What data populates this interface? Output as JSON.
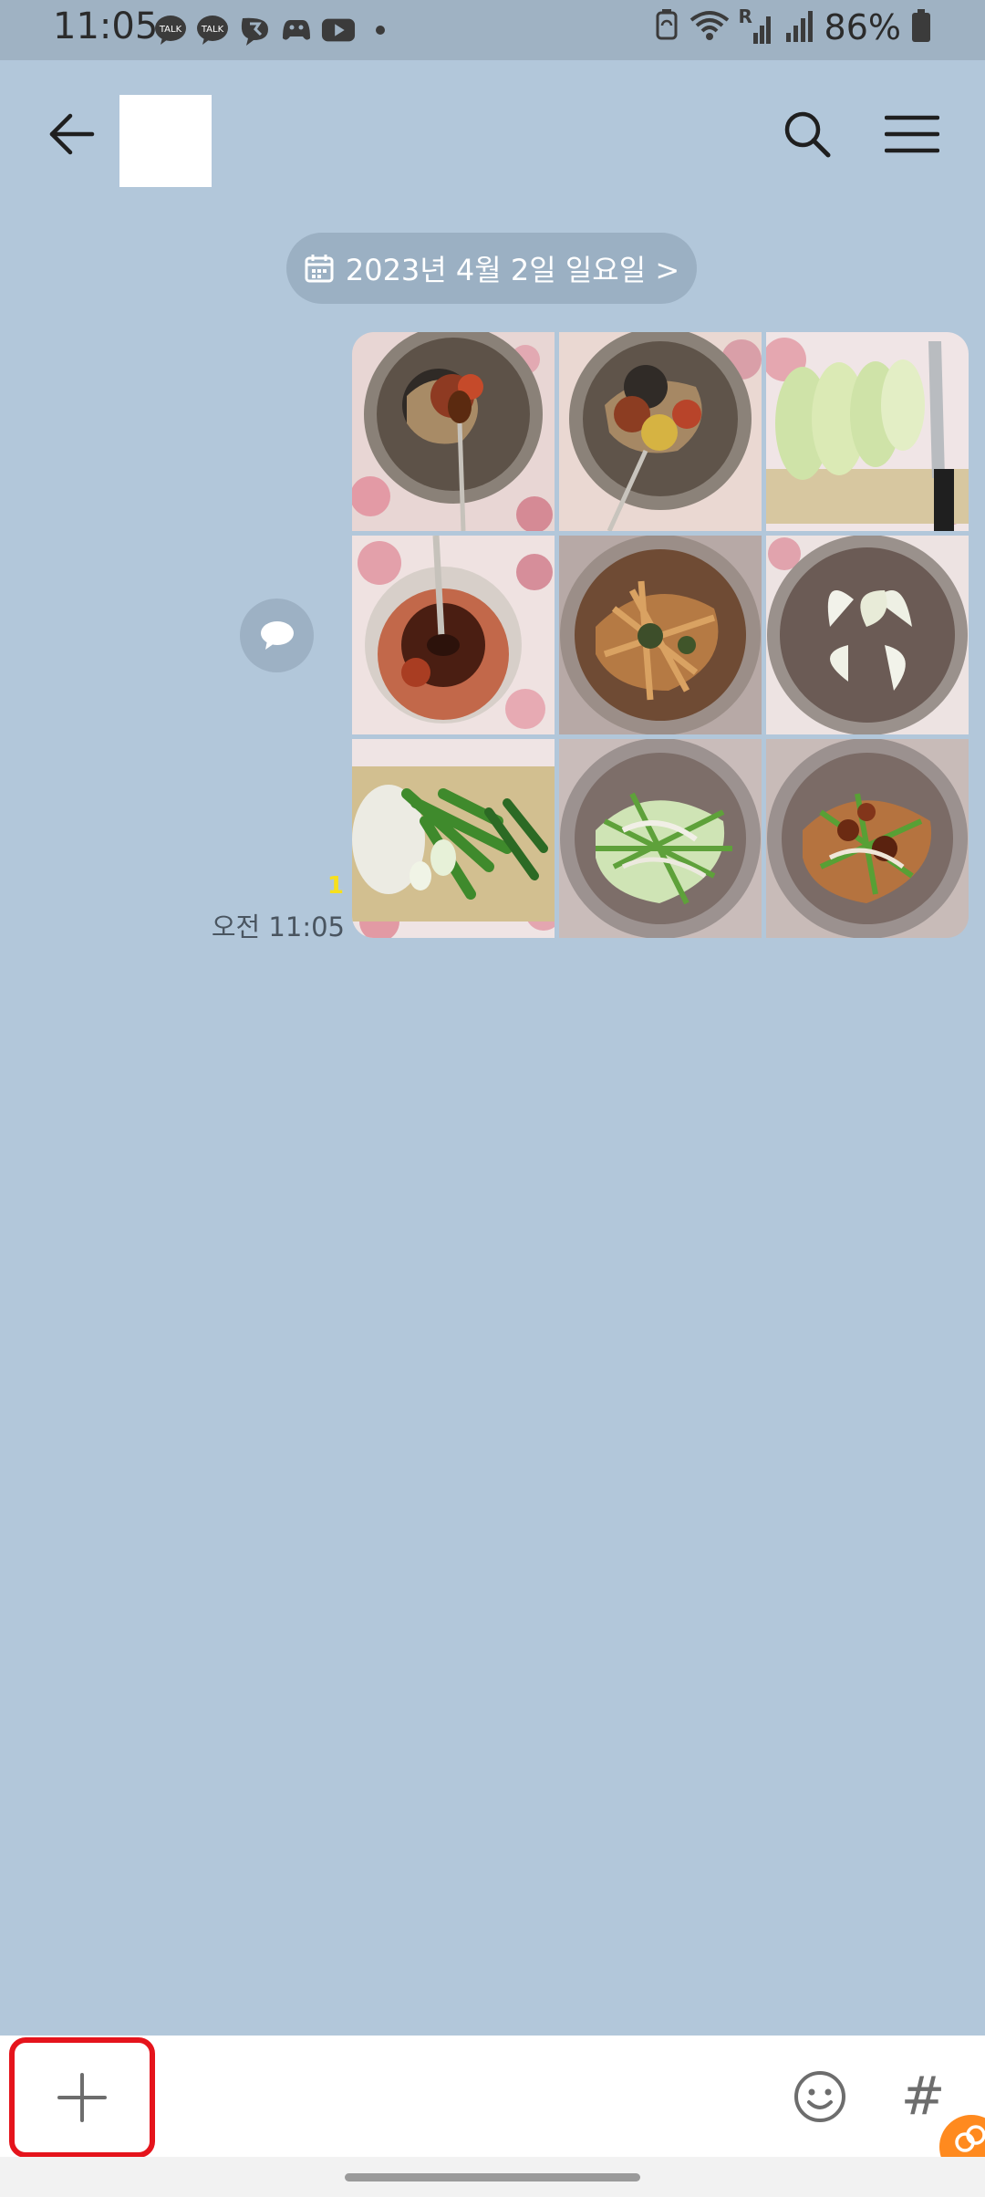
{
  "status_bar": {
    "time": "11:05",
    "battery": "86%",
    "notifications": [
      {
        "icon": "kakaotalk-icon",
        "label": "TALK"
      },
      {
        "icon": "kakaotalk-icon",
        "label": "TALK"
      },
      {
        "icon": "kakao-story-icon",
        "label": ""
      },
      {
        "icon": "game-icon",
        "label": ""
      },
      {
        "icon": "youtube-icon",
        "label": ""
      },
      {
        "icon": "more-dot-icon",
        "label": ""
      }
    ],
    "system_icons": [
      "recycle-icon",
      "wifi-icon",
      "roaming-signal-icon",
      "signal-icon",
      "battery-icon"
    ],
    "roaming_label": "R"
  },
  "header": {
    "back_icon": "back-arrow-icon",
    "search_icon": "search-icon",
    "menu_icon": "hamburger-menu-icon"
  },
  "chat": {
    "date_chip": "2023년 4월 2일 일요일 >",
    "message": {
      "unread_count": "1",
      "time": "오전 11:05",
      "photo_count": 9,
      "photos": [
        "noodles-with-spoon",
        "noodles-with-sauce",
        "sliced-pear-and-knife",
        "chili-sauce-bowl",
        "seasoned-noodles",
        "pear-slices-in-pot",
        "green-onions-on-board",
        "vegetables-in-pot",
        "mixed-salad-in-pot"
      ]
    }
  },
  "input_bar": {
    "plus_icon": "plus-icon",
    "emoji_icon": "emoji-icon",
    "hashtag_label": "#"
  },
  "colors": {
    "background": "#b2c7da",
    "status_bar": "#9fb2c3",
    "date_chip": "#9bb0c3",
    "highlight_border": "#e5141c",
    "unread": "#f7e01c"
  }
}
